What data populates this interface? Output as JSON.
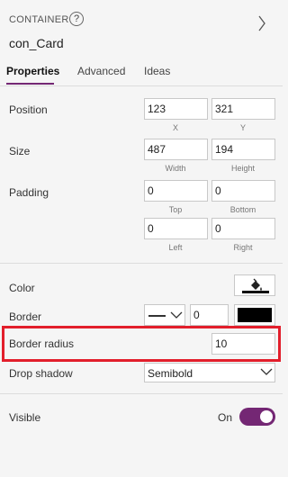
{
  "header": {
    "type_label": "CONTAINER",
    "help_glyph": "?",
    "control_name": "con_Card",
    "expand_icon": "chevron-right-icon"
  },
  "tabs": [
    {
      "label": "Properties",
      "active": true
    },
    {
      "label": "Advanced",
      "active": false
    },
    {
      "label": "Ideas",
      "active": false
    }
  ],
  "accent_color": "#742774",
  "highlight_color": "#e21e2b",
  "properties": {
    "position": {
      "label": "Position",
      "x": "123",
      "y": "321",
      "x_caption": "X",
      "y_caption": "Y"
    },
    "size": {
      "label": "Size",
      "width": "487",
      "height": "194",
      "width_caption": "Width",
      "height_caption": "Height"
    },
    "padding": {
      "label": "Padding",
      "top": "0",
      "bottom": "0",
      "left": "0",
      "right": "0",
      "top_caption": "Top",
      "bottom_caption": "Bottom",
      "left_caption": "Left",
      "right_caption": "Right"
    },
    "color": {
      "label": "Color",
      "icon": "paint-bucket-icon"
    },
    "border": {
      "label": "Border",
      "style": "solid",
      "width": "0",
      "color": "#000000"
    },
    "border_radius": {
      "label": "Border radius",
      "value": "10"
    },
    "drop_shadow": {
      "label": "Drop shadow",
      "value": "Semibold"
    },
    "visible": {
      "label": "Visible",
      "state_text": "On",
      "on": true
    }
  }
}
